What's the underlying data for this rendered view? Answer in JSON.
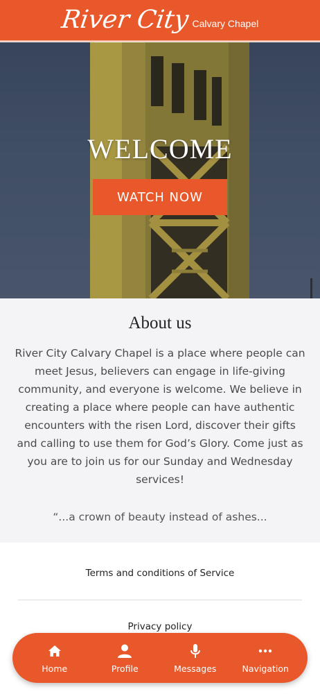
{
  "header": {
    "logo_script": "River City",
    "logo_sub": "Calvary Chapel"
  },
  "hero": {
    "title": "WELCOME",
    "cta_label": "WATCH NOW"
  },
  "about": {
    "title": "About us",
    "body": "River City Calvary Chapel is a place where people can meet Jesus, believers can engage in life-giving community, and everyone is welcome. We believe in creating a place where people can have authentic encounters with the risen Lord, discover their gifts and calling to use them for God’s Glory. Come just as you are to join us for our Sunday and Wednesday services!",
    "quote": "“...a crown of beauty instead of ashes..."
  },
  "links": {
    "terms": "Terms and conditions of Service",
    "privacy": "Privacy policy"
  },
  "bottom_nav": {
    "items": [
      {
        "label": "Home",
        "icon": "home-icon"
      },
      {
        "label": "Profile",
        "icon": "profile-icon"
      },
      {
        "label": "Messages",
        "icon": "microphone-icon"
      },
      {
        "label": "Navigation",
        "icon": "more-dots-icon"
      }
    ]
  },
  "colors": {
    "accent": "#e8582a",
    "about_bg": "#f4f3f6",
    "hero_sky": "#4a5a74"
  }
}
